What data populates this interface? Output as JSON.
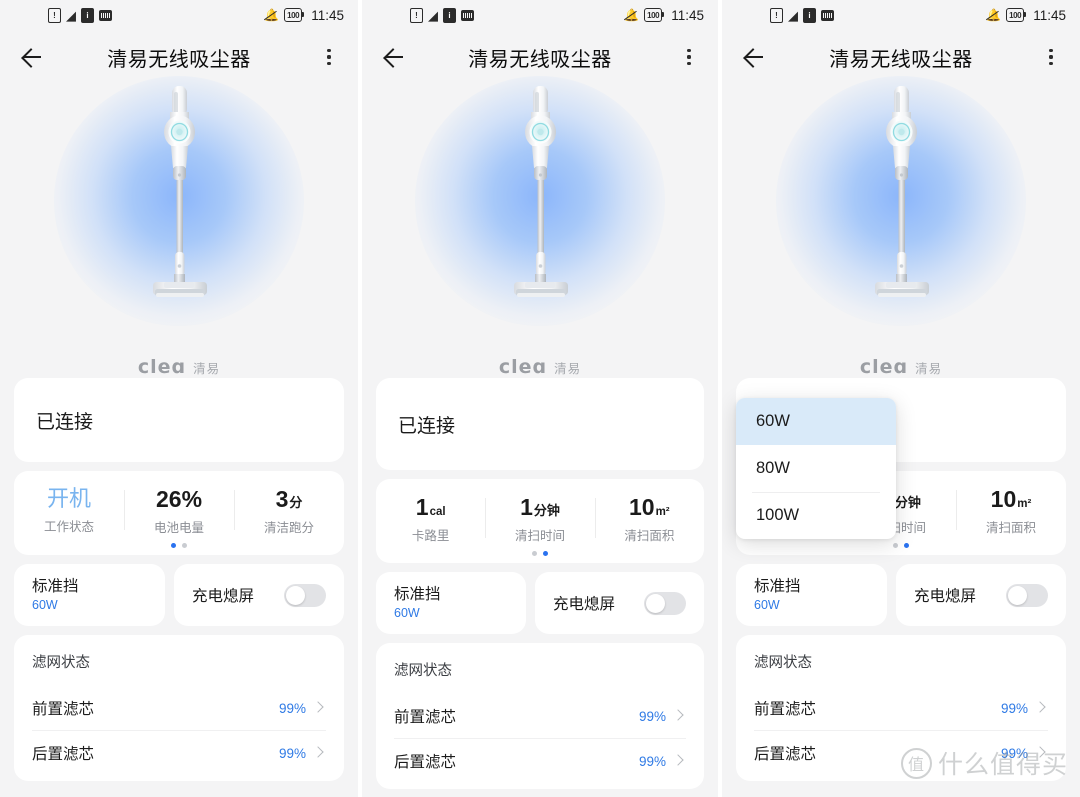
{
  "statusbar": {
    "time": "11:45",
    "battery": "100",
    "icons_left": [
      "sim-card-icon",
      "wifi-icon",
      "signal-icon",
      "sd-card-icon"
    ],
    "icons_right": [
      "bell-off-icon",
      "battery-icon"
    ]
  },
  "nav": {
    "back": "back-arrow-icon",
    "title": "清易无线吸尘器",
    "more": "more-options-icon"
  },
  "hero": {
    "device": "cordless-vacuum-image",
    "brand_mark": "cleɑ",
    "brand_cn": "清易"
  },
  "status_card": {
    "label": "已连接"
  },
  "stats_page1": {
    "items": [
      {
        "value": "开机",
        "unit": "",
        "label": "工作状态",
        "accent": "#79b4ef"
      },
      {
        "value": "26",
        "unit": "%",
        "label": "电池电量",
        "accent": "#1b1b1b"
      },
      {
        "value": "3",
        "unit": "分",
        "label": "清洁跑分",
        "accent": "#1b1b1b"
      }
    ],
    "active_dot": 0
  },
  "stats_page2": {
    "items": [
      {
        "value": "1",
        "unit": "cal",
        "label": "卡路里",
        "accent": "#1b1b1b"
      },
      {
        "value": "1",
        "unit": "分钟",
        "label": "清扫时间",
        "accent": "#1b1b1b"
      },
      {
        "value": "10",
        "unit": "m²",
        "label": "清扫面积",
        "accent": "#1b1b1b"
      }
    ],
    "active_dot": 1
  },
  "controls": {
    "mode_name": "标准挡",
    "mode_watt": "60W",
    "toggle_label": "充电熄屏",
    "toggle_on": false
  },
  "filters": {
    "title": "滤网状态",
    "rows": [
      {
        "name": "前置滤芯",
        "value": "99%",
        "chevron": "chevron-right-icon"
      },
      {
        "name": "后置滤芯",
        "value": "99%",
        "chevron": "chevron-right-icon"
      }
    ]
  },
  "dropdown": {
    "options": [
      {
        "label": "60W",
        "selected": true
      },
      {
        "label": "80W",
        "selected": false
      },
      {
        "label": "100W",
        "selected": false
      }
    ],
    "selected_bg": "#d9eaf9"
  },
  "watermark": {
    "mark": "值",
    "text": "什么值得买"
  },
  "colors": {
    "page_bg": "#f4f4f5",
    "card_bg": "#ffffff",
    "accent_blue": "#2f7ae5",
    "light_blue": "#79b4ef",
    "muted": "#8b8e94"
  }
}
